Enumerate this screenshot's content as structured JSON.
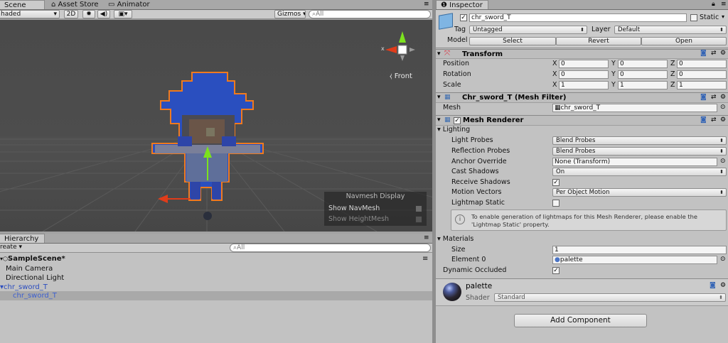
{
  "scene_tabs": {
    "scene": "Scene",
    "asset_store": "Asset Store",
    "animator": "Animator"
  },
  "scene_toolbar": {
    "shading": "haded",
    "mode_2d": "2D",
    "gizmos": "Gizmos",
    "search_placeholder": "All"
  },
  "scene_view": {
    "front_label": "Front",
    "x_axis": "x"
  },
  "navmesh": {
    "title": "Navmesh Display",
    "show_navmesh": "Show NavMesh",
    "show_heightmesh": "Show HeightMesh"
  },
  "hierarchy": {
    "tab": "Hierarchy",
    "create": "reate",
    "search_placeholder": "All",
    "scene": "SampleScene*",
    "items": [
      "Main Camera",
      "Directional Light",
      "chr_sword_T",
      "chr_sword_T"
    ]
  },
  "inspector": {
    "tab": "Inspector",
    "object_name": "chr_sword_T",
    "static_label": "Static",
    "tag_label": "Tag",
    "tag_value": "Untagged",
    "layer_label": "Layer",
    "layer_value": "Default",
    "model_label": "Model",
    "model_buttons": [
      "Select",
      "Revert",
      "Open"
    ],
    "transform": {
      "title": "Transform",
      "rows": [
        {
          "label": "Position",
          "x": "0",
          "y": "0",
          "z": "0"
        },
        {
          "label": "Rotation",
          "x": "0",
          "y": "0",
          "z": "0"
        },
        {
          "label": "Scale",
          "x": "1",
          "y": "1",
          "z": "1"
        }
      ]
    },
    "mesh_filter": {
      "title": "Chr_sword_T (Mesh Filter)",
      "mesh_label": "Mesh",
      "mesh_value": "chr_sword_T"
    },
    "mesh_renderer": {
      "title": "Mesh Renderer",
      "lighting": "Lighting",
      "light_probes": {
        "label": "Light Probes",
        "value": "Blend Probes"
      },
      "reflection_probes": {
        "label": "Reflection Probes",
        "value": "Blend Probes"
      },
      "anchor_override": {
        "label": "Anchor Override",
        "value": "None (Transform)"
      },
      "cast_shadows": {
        "label": "Cast Shadows",
        "value": "On"
      },
      "receive_shadows": {
        "label": "Receive Shadows"
      },
      "motion_vectors": {
        "label": "Motion Vectors",
        "value": "Per Object Motion"
      },
      "lightmap_static": {
        "label": "Lightmap Static"
      },
      "info": "To enable generation of lightmaps for this Mesh Renderer, please enable the 'Lightmap Static' property.",
      "materials": "Materials",
      "size_label": "Size",
      "size_value": "1",
      "element0_label": "Element 0",
      "element0_value": "palette",
      "dynamic_occluded": "Dynamic Occluded"
    },
    "material": {
      "name": "palette",
      "shader_label": "Shader",
      "shader_value": "Standard"
    },
    "add_component": "Add Component"
  },
  "colors": {
    "selection": "#a9a9a9",
    "accent_blue": "#3c5fd0",
    "outline": "#f07a1e"
  }
}
